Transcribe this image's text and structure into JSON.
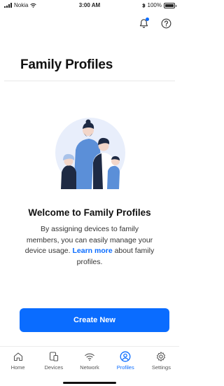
{
  "status_bar": {
    "carrier": "Nokia",
    "time": "3:00 AM",
    "battery": "100%"
  },
  "header": {
    "title": "Family Profiles"
  },
  "welcome": {
    "title": "Welcome to Family Profiles",
    "body_before": "By assigning devices to family members, you can easily manage your device usage.",
    "learn_more": "Learn more",
    "body_after": "about family profiles."
  },
  "create_button": {
    "label": "Create New"
  },
  "tabs": [
    {
      "label": "Home",
      "icon": "home-icon"
    },
    {
      "label": "Devices",
      "icon": "devices-icon"
    },
    {
      "label": "Network",
      "icon": "wifi-icon"
    },
    {
      "label": "Profiles",
      "icon": "profile-icon",
      "active": true
    },
    {
      "label": "Settings",
      "icon": "gear-icon"
    }
  ],
  "colors": {
    "accent": "#0a6cff"
  }
}
